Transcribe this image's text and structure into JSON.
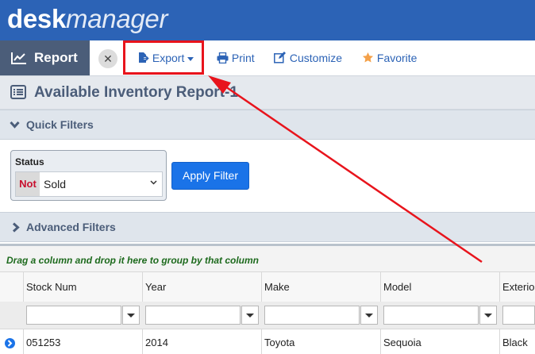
{
  "app": {
    "logo_bold": "desk",
    "logo_light": "manager"
  },
  "toolbar": {
    "report_label": "Report",
    "close_label": "✕",
    "export_label": "Export",
    "print_label": "Print",
    "customize_label": "Customize",
    "favorite_label": "Favorite"
  },
  "page": {
    "title": "Available Inventory Report-1"
  },
  "quick_filters": {
    "label": "Quick Filters",
    "status": {
      "label": "Status",
      "not_badge": "Not",
      "value": "Sold"
    },
    "apply_label": "Apply Filter"
  },
  "advanced_filters": {
    "label": "Advanced Filters"
  },
  "grid": {
    "group_hint": "Drag a column and drop it here to group by that column",
    "columns": [
      "Stock Num",
      "Year",
      "Make",
      "Model",
      "Exterio"
    ],
    "rows": [
      {
        "stock_num": "051253",
        "year": "2014",
        "make": "Toyota",
        "model": "Sequoia",
        "exterior": "Black"
      }
    ]
  },
  "colors": {
    "header": "#2c63b6",
    "accent": "#1a73e8",
    "annotation": "#e8141c"
  }
}
